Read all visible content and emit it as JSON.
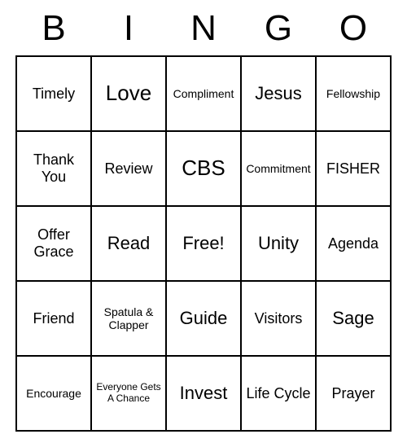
{
  "header": [
    "B",
    "I",
    "N",
    "G",
    "O"
  ],
  "cells": [
    [
      {
        "text": "Timely",
        "size": "fs-small"
      },
      {
        "text": "Love",
        "size": "fs-large"
      },
      {
        "text": "Compliment",
        "size": "fs-xs"
      },
      {
        "text": "Jesus",
        "size": "fs-med"
      },
      {
        "text": "Fellowship",
        "size": "fs-xs"
      }
    ],
    [
      {
        "text": "Thank You",
        "size": "fs-small"
      },
      {
        "text": "Review",
        "size": "fs-small"
      },
      {
        "text": "CBS",
        "size": "fs-large"
      },
      {
        "text": "Commitment",
        "size": "fs-xs"
      },
      {
        "text": "FISHER",
        "size": "fs-small"
      }
    ],
    [
      {
        "text": "Offer Grace",
        "size": "fs-small"
      },
      {
        "text": "Read",
        "size": "fs-med"
      },
      {
        "text": "Free!",
        "size": "fs-med"
      },
      {
        "text": "Unity",
        "size": "fs-med"
      },
      {
        "text": "Agenda",
        "size": "fs-small"
      }
    ],
    [
      {
        "text": "Friend",
        "size": "fs-small"
      },
      {
        "text": "Spatula & Clapper",
        "size": "fs-xs"
      },
      {
        "text": "Guide",
        "size": "fs-med"
      },
      {
        "text": "Visitors",
        "size": "fs-small"
      },
      {
        "text": "Sage",
        "size": "fs-med"
      }
    ],
    [
      {
        "text": "Encourage",
        "size": "fs-xs"
      },
      {
        "text": "Everyone Gets A Chance",
        "size": "fs-xxs"
      },
      {
        "text": "Invest",
        "size": "fs-med"
      },
      {
        "text": "Life Cycle",
        "size": "fs-small"
      },
      {
        "text": "Prayer",
        "size": "fs-small"
      }
    ]
  ]
}
